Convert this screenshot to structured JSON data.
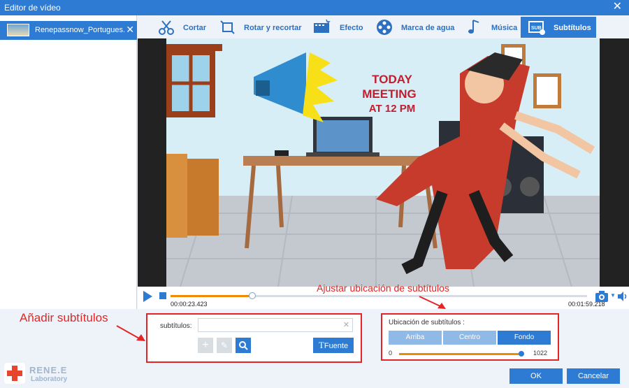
{
  "window": {
    "title": "Editor de vídeo",
    "close": "✕"
  },
  "file": {
    "name": "Renepassnow_Portugues...",
    "remove": "✕"
  },
  "tabs": [
    {
      "label": "Cortar"
    },
    {
      "label": "Rotar y recortar"
    },
    {
      "label": "Efecto"
    },
    {
      "label": "Marca de agua"
    },
    {
      "label": "Música"
    },
    {
      "label": "Subtítulos",
      "active": true
    }
  ],
  "scene_text": {
    "line1": "TODAY",
    "line2": "MEETING",
    "line3": "AT 12 PM"
  },
  "player": {
    "current_time": "00:00:23.423",
    "total_time": "00:01:59.218",
    "progress": 0.197
  },
  "annotations": {
    "position": "Ajustar ubicación de subtítulos",
    "add": "Añadir subtítulos"
  },
  "subtitles": {
    "label": "subtítulos:",
    "value": "",
    "font_button": "Fuente",
    "font_icon": "T"
  },
  "location": {
    "label": "Ubicación de subtítulos :",
    "options": [
      "Arriba",
      "Centro",
      "Fondo"
    ],
    "selected": "Fondo",
    "slider_min": "0",
    "slider_max": "1022",
    "slider_value_fraction": 0.985
  },
  "brand": {
    "name": "RENE.E",
    "sub": "Laboratory"
  },
  "buttons": {
    "ok": "OK",
    "cancel": "Cancelar"
  },
  "colors": {
    "accent": "#2d7bd3",
    "annotation": "#e52525",
    "progress": "#f08a00"
  }
}
